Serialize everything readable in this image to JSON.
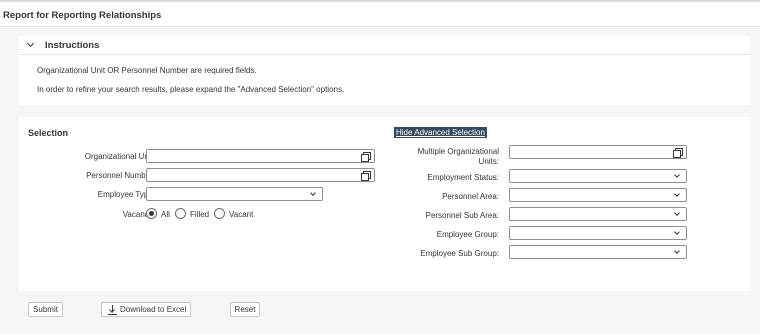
{
  "header": {
    "title": "Report for Reporting Relationships"
  },
  "instructions": {
    "title": "Instructions",
    "line1": "Organizational Unit OR Personnel Number are required fields.",
    "line2": "In order to refine your search results, please expand the \"Advanced Selection\" options."
  },
  "selection": {
    "title": "Selection",
    "advanced_link": "Hide Advanced Selection",
    "org_unit": {
      "label": "Organizational Unit:",
      "value": ""
    },
    "personnel_number": {
      "label": "Personnel Number:",
      "value": ""
    },
    "employee_type": {
      "label": "Employee Type:",
      "value": ""
    },
    "vacancy": {
      "label": "Vacancy:",
      "options": [
        "All",
        "Filled",
        "Vacant"
      ],
      "selected": "All"
    },
    "multiple_org_units": {
      "label_line1": "Multiple Organizational",
      "label_line2": "Units:",
      "value": ""
    },
    "employment_status": {
      "label": "Employment Status:",
      "value": ""
    },
    "personnel_area": {
      "label": "Personnel Area:",
      "value": ""
    },
    "personnel_sub_area": {
      "label": "Personnel Sub Area:",
      "value": ""
    },
    "employee_group": {
      "label": "Employee Group:",
      "value": ""
    },
    "employee_sub_group": {
      "label": "Employee Sub Group:",
      "value": ""
    }
  },
  "footer": {
    "submit_label": "Submit",
    "download_label": "Download to Excel",
    "reset_label": "Reset"
  },
  "icons": {
    "collapse": "chevron-down-icon",
    "value_help": "value-help-icon",
    "dropdown": "chevron-down-icon",
    "download": "download-icon"
  }
}
